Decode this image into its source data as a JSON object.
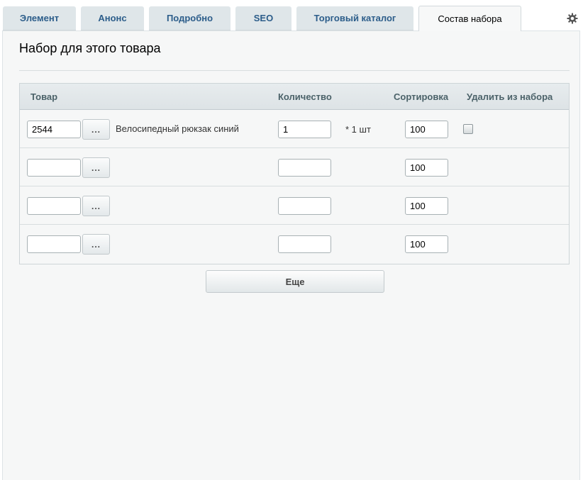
{
  "tabs": [
    {
      "label": "Элемент",
      "active": false
    },
    {
      "label": "Анонс",
      "active": false
    },
    {
      "label": "Подробно",
      "active": false
    },
    {
      "label": "SEO",
      "active": false
    },
    {
      "label": "Торговый каталог",
      "active": false
    },
    {
      "label": "Состав набора",
      "active": true
    }
  ],
  "settings_icon": "gear-icon",
  "section": {
    "title": "Набор для этого товара"
  },
  "table": {
    "headers": {
      "product": "Товар",
      "quantity": "Количество",
      "sort": "Сортировка",
      "delete": "Удалить из набора"
    },
    "rows": [
      {
        "product_id": "2544",
        "browse_label": "...",
        "product_name": "Велосипедный рюкзак синий",
        "quantity": "1",
        "unit": "* 1 шт",
        "sort": "100",
        "has_delete": true
      },
      {
        "product_id": "",
        "browse_label": "...",
        "product_name": "",
        "quantity": "",
        "unit": "",
        "sort": "100",
        "has_delete": false
      },
      {
        "product_id": "",
        "browse_label": "...",
        "product_name": "",
        "quantity": "",
        "unit": "",
        "sort": "100",
        "has_delete": false
      },
      {
        "product_id": "",
        "browse_label": "...",
        "product_name": "",
        "quantity": "",
        "unit": "",
        "sort": "100",
        "has_delete": false
      }
    ]
  },
  "more_button": "Еще",
  "colors": {
    "tab_text": "#2c5d8a",
    "panel_bg": "#f6f7f7",
    "header_bg": "#e3e8ea"
  }
}
